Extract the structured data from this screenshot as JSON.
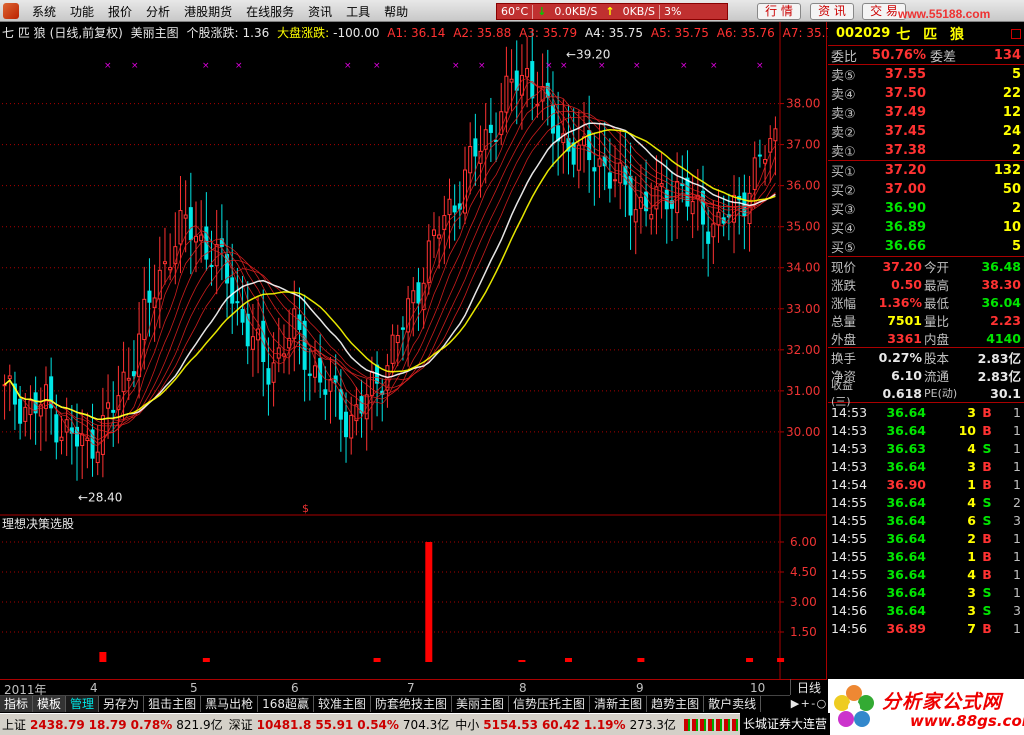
{
  "menu": [
    "系统",
    "功能",
    "报价",
    "分析",
    "港股期货",
    "在线服务",
    "资讯",
    "工具",
    "帮助"
  ],
  "status": {
    "temp": "60°C",
    "down_speed": "0.0KB/S",
    "up_speed": "0KB/S",
    "percent": "3%"
  },
  "top_buttons": [
    "行 情",
    "资 讯",
    "交 易"
  ],
  "watermark_top": "www.55188.com",
  "chart_header": {
    "name": "七 匹 狼",
    "mode": "(日线,前复权)",
    "indicator": "美丽主图",
    "stock_chg_label": "个股涨跌:",
    "stock_chg": "1.36",
    "market_chg_label": "大盘涨跌:",
    "market_chg": "-100.00",
    "a_values": [
      "A1: 36.14",
      "A2: 35.88",
      "A3: 35.79",
      "A4: 35.75",
      "A5: 35.75",
      "A6: 35.76",
      "A7: 35.78",
      "A8"
    ]
  },
  "chart_labels": {
    "high": "39.20",
    "low": "←28.40",
    "marker": "$"
  },
  "sub_chart_title": "理想决策选股",
  "chart_data": [
    {
      "type": "candlestick",
      "title": "七 匹 狼 (日线,前复权)",
      "y_ticks": [
        38.0,
        37.0,
        36.0,
        35.0,
        34.0,
        33.0,
        32.0,
        31.0,
        30.0
      ],
      "ylim": [
        28.0,
        39.5
      ],
      "x_labels": [
        "2011年",
        "4",
        "5",
        "6",
        "7",
        "8",
        "9",
        "10"
      ],
      "annotations": {
        "max": 39.2,
        "min": 28.4
      },
      "series_close": [
        30.9,
        30.8,
        30.5,
        30.7,
        30.2,
        29.8,
        29.6,
        30.1,
        30.6,
        31.5,
        32.6,
        33.5,
        34.5,
        35.0,
        34.8,
        34.4,
        33.9,
        33.0,
        32.2,
        31.5,
        32.0,
        32.5,
        31.8,
        31.2,
        30.8,
        30.3,
        30.6,
        31.2,
        31.9,
        32.6,
        33.6,
        34.5,
        35.2,
        35.9,
        36.6,
        37.2,
        37.8,
        38.5,
        38.8,
        38.0,
        37.4,
        37.0,
        36.6,
        36.8,
        36.2,
        35.9,
        35.6,
        35.4,
        35.8,
        36.0,
        35.4,
        35.2,
        35.0,
        35.4,
        36.0,
        36.6,
        37.2
      ]
    },
    {
      "type": "bar",
      "title": "理想决策选股",
      "y_ticks": [
        6.0,
        4.5,
        3.0,
        1.5
      ],
      "ylim": [
        0,
        6.5
      ],
      "signals": [
        {
          "x_index": 19,
          "value": 0.5
        },
        {
          "x_index": 39,
          "value": 0.2
        },
        {
          "x_index": 72,
          "value": 0.2
        },
        {
          "x_index": 82,
          "value": 6.0
        },
        {
          "x_index": 100,
          "value": 0.1
        },
        {
          "x_index": 109,
          "value": 0.2
        },
        {
          "x_index": 123,
          "value": 0.2
        },
        {
          "x_index": 144,
          "value": 0.2
        },
        {
          "x_index": 150,
          "value": 0.2
        }
      ]
    }
  ],
  "stock": {
    "code": "002029",
    "name": "七 匹 狼"
  },
  "weibi": {
    "label1": "委比",
    "val1": "50.76%",
    "label2": "委差",
    "val2": "134"
  },
  "sell": [
    {
      "label": "卖⑤",
      "price": "37.55",
      "vol": "5"
    },
    {
      "label": "卖④",
      "price": "37.50",
      "vol": "22"
    },
    {
      "label": "卖③",
      "price": "37.49",
      "vol": "12"
    },
    {
      "label": "卖②",
      "price": "37.45",
      "vol": "24"
    },
    {
      "label": "卖①",
      "price": "37.38",
      "vol": "2"
    }
  ],
  "buy": [
    {
      "label": "买①",
      "price": "37.20",
      "vol": "132"
    },
    {
      "label": "买②",
      "price": "37.00",
      "vol": "50"
    },
    {
      "label": "买③",
      "price": "36.90",
      "vol": "2"
    },
    {
      "label": "买④",
      "price": "36.89",
      "vol": "10"
    },
    {
      "label": "买⑤",
      "price": "36.66",
      "vol": "5"
    }
  ],
  "quote1": [
    {
      "l1": "现价",
      "v1": "37.20",
      "c1": "red",
      "l2": "今开",
      "v2": "36.48",
      "c2": "green"
    },
    {
      "l1": "涨跌",
      "v1": "0.50",
      "c1": "red",
      "l2": "最高",
      "v2": "38.30",
      "c2": "red"
    },
    {
      "l1": "涨幅",
      "v1": "1.36%",
      "c1": "red",
      "l2": "最低",
      "v2": "36.04",
      "c2": "green"
    },
    {
      "l1": "总量",
      "v1": "7501",
      "c1": "yellow",
      "l2": "量比",
      "v2": "2.23",
      "c2": "red"
    },
    {
      "l1": "外盘",
      "v1": "3361",
      "c1": "red",
      "l2": "内盘",
      "v2": "4140",
      "c2": "green"
    }
  ],
  "quote2": [
    {
      "l1": "换手",
      "v1": "0.27%",
      "c1": "white",
      "l2": "股本",
      "v2": "2.83亿",
      "c2": "white"
    },
    {
      "l1": "净资",
      "v1": "6.10",
      "c1": "white",
      "l2": "流通",
      "v2": "2.83亿",
      "c2": "white"
    },
    {
      "l1": "收益(三)",
      "v1": "0.618",
      "c1": "white",
      "l2": "PE(动)",
      "v2": "30.1",
      "c2": "white"
    }
  ],
  "ticks": [
    {
      "time": "14:53",
      "price": "36.64",
      "pc": "green",
      "vol": "3",
      "vc": "yellow",
      "bs": "B",
      "bsc": "red",
      "n": "1"
    },
    {
      "time": "14:53",
      "price": "36.64",
      "pc": "green",
      "vol": "10",
      "vc": "yellow",
      "bs": "B",
      "bsc": "red",
      "n": "1"
    },
    {
      "time": "14:53",
      "price": "36.63",
      "pc": "green",
      "vol": "4",
      "vc": "yellow",
      "bs": "S",
      "bsc": "green",
      "n": "1"
    },
    {
      "time": "14:53",
      "price": "36.64",
      "pc": "green",
      "vol": "3",
      "vc": "yellow",
      "bs": "B",
      "bsc": "red",
      "n": "1"
    },
    {
      "time": "14:54",
      "price": "36.90",
      "pc": "red",
      "vol": "1",
      "vc": "yellow",
      "bs": "B",
      "bsc": "red",
      "n": "1"
    },
    {
      "time": "14:55",
      "price": "36.64",
      "pc": "green",
      "vol": "4",
      "vc": "yellow",
      "bs": "S",
      "bsc": "green",
      "n": "2"
    },
    {
      "time": "14:55",
      "price": "36.64",
      "pc": "green",
      "vol": "6",
      "vc": "yellow",
      "bs": "S",
      "bsc": "green",
      "n": "3"
    },
    {
      "time": "14:55",
      "price": "36.64",
      "pc": "green",
      "vol": "2",
      "vc": "yellow",
      "bs": "B",
      "bsc": "red",
      "n": "1"
    },
    {
      "time": "14:55",
      "price": "36.64",
      "pc": "green",
      "vol": "1",
      "vc": "yellow",
      "bs": "B",
      "bsc": "red",
      "n": "1"
    },
    {
      "time": "14:55",
      "price": "36.64",
      "pc": "green",
      "vol": "4",
      "vc": "yellow",
      "bs": "B",
      "bsc": "red",
      "n": "1"
    },
    {
      "time": "14:56",
      "price": "36.64",
      "pc": "green",
      "vol": "3",
      "vc": "yellow",
      "bs": "S",
      "bsc": "green",
      "n": "1"
    },
    {
      "time": "14:56",
      "price": "36.64",
      "pc": "green",
      "vol": "3",
      "vc": "yellow",
      "bs": "S",
      "bsc": "green",
      "n": "3"
    },
    {
      "time": "14:56",
      "price": "36.89",
      "pc": "red",
      "vol": "7",
      "vc": "yellow",
      "bs": "B",
      "bsc": "red",
      "n": "1"
    }
  ],
  "tabs": [
    "指标",
    "模板",
    "管理",
    "另存为",
    "狙击主图",
    "黑马出枪",
    "168超赢",
    "较准主图",
    "防套绝技主图",
    "美丽主图",
    "信势压托主图",
    "清新主图",
    "趋势主图",
    "散户卖线"
  ],
  "period": "日线",
  "nav": [
    "▶",
    "+",
    "-",
    "○"
  ],
  "statusbar": [
    {
      "name": "上证",
      "v1": "2438.79",
      "v2": "18.79",
      "v3": "0.78%",
      "v4": "821.9亿"
    },
    {
      "name": "深证",
      "v1": "10481.8",
      "v2": "55.91",
      "v3": "0.54%",
      "v4": "704.3亿"
    },
    {
      "name": "中小",
      "v1": "5154.53",
      "v2": "60.42",
      "v3": "1.19%",
      "v4": "273.3亿"
    }
  ],
  "broker": "长城证券大连营",
  "logo": {
    "brand": "分析家公式网",
    "url": "www.88gs.com"
  },
  "colors": {
    "up": "#ff3232",
    "down": "#00e6e6",
    "ma_fast": "#ffffff",
    "ma_slow": "#ffff00",
    "grid": "#a00000"
  }
}
